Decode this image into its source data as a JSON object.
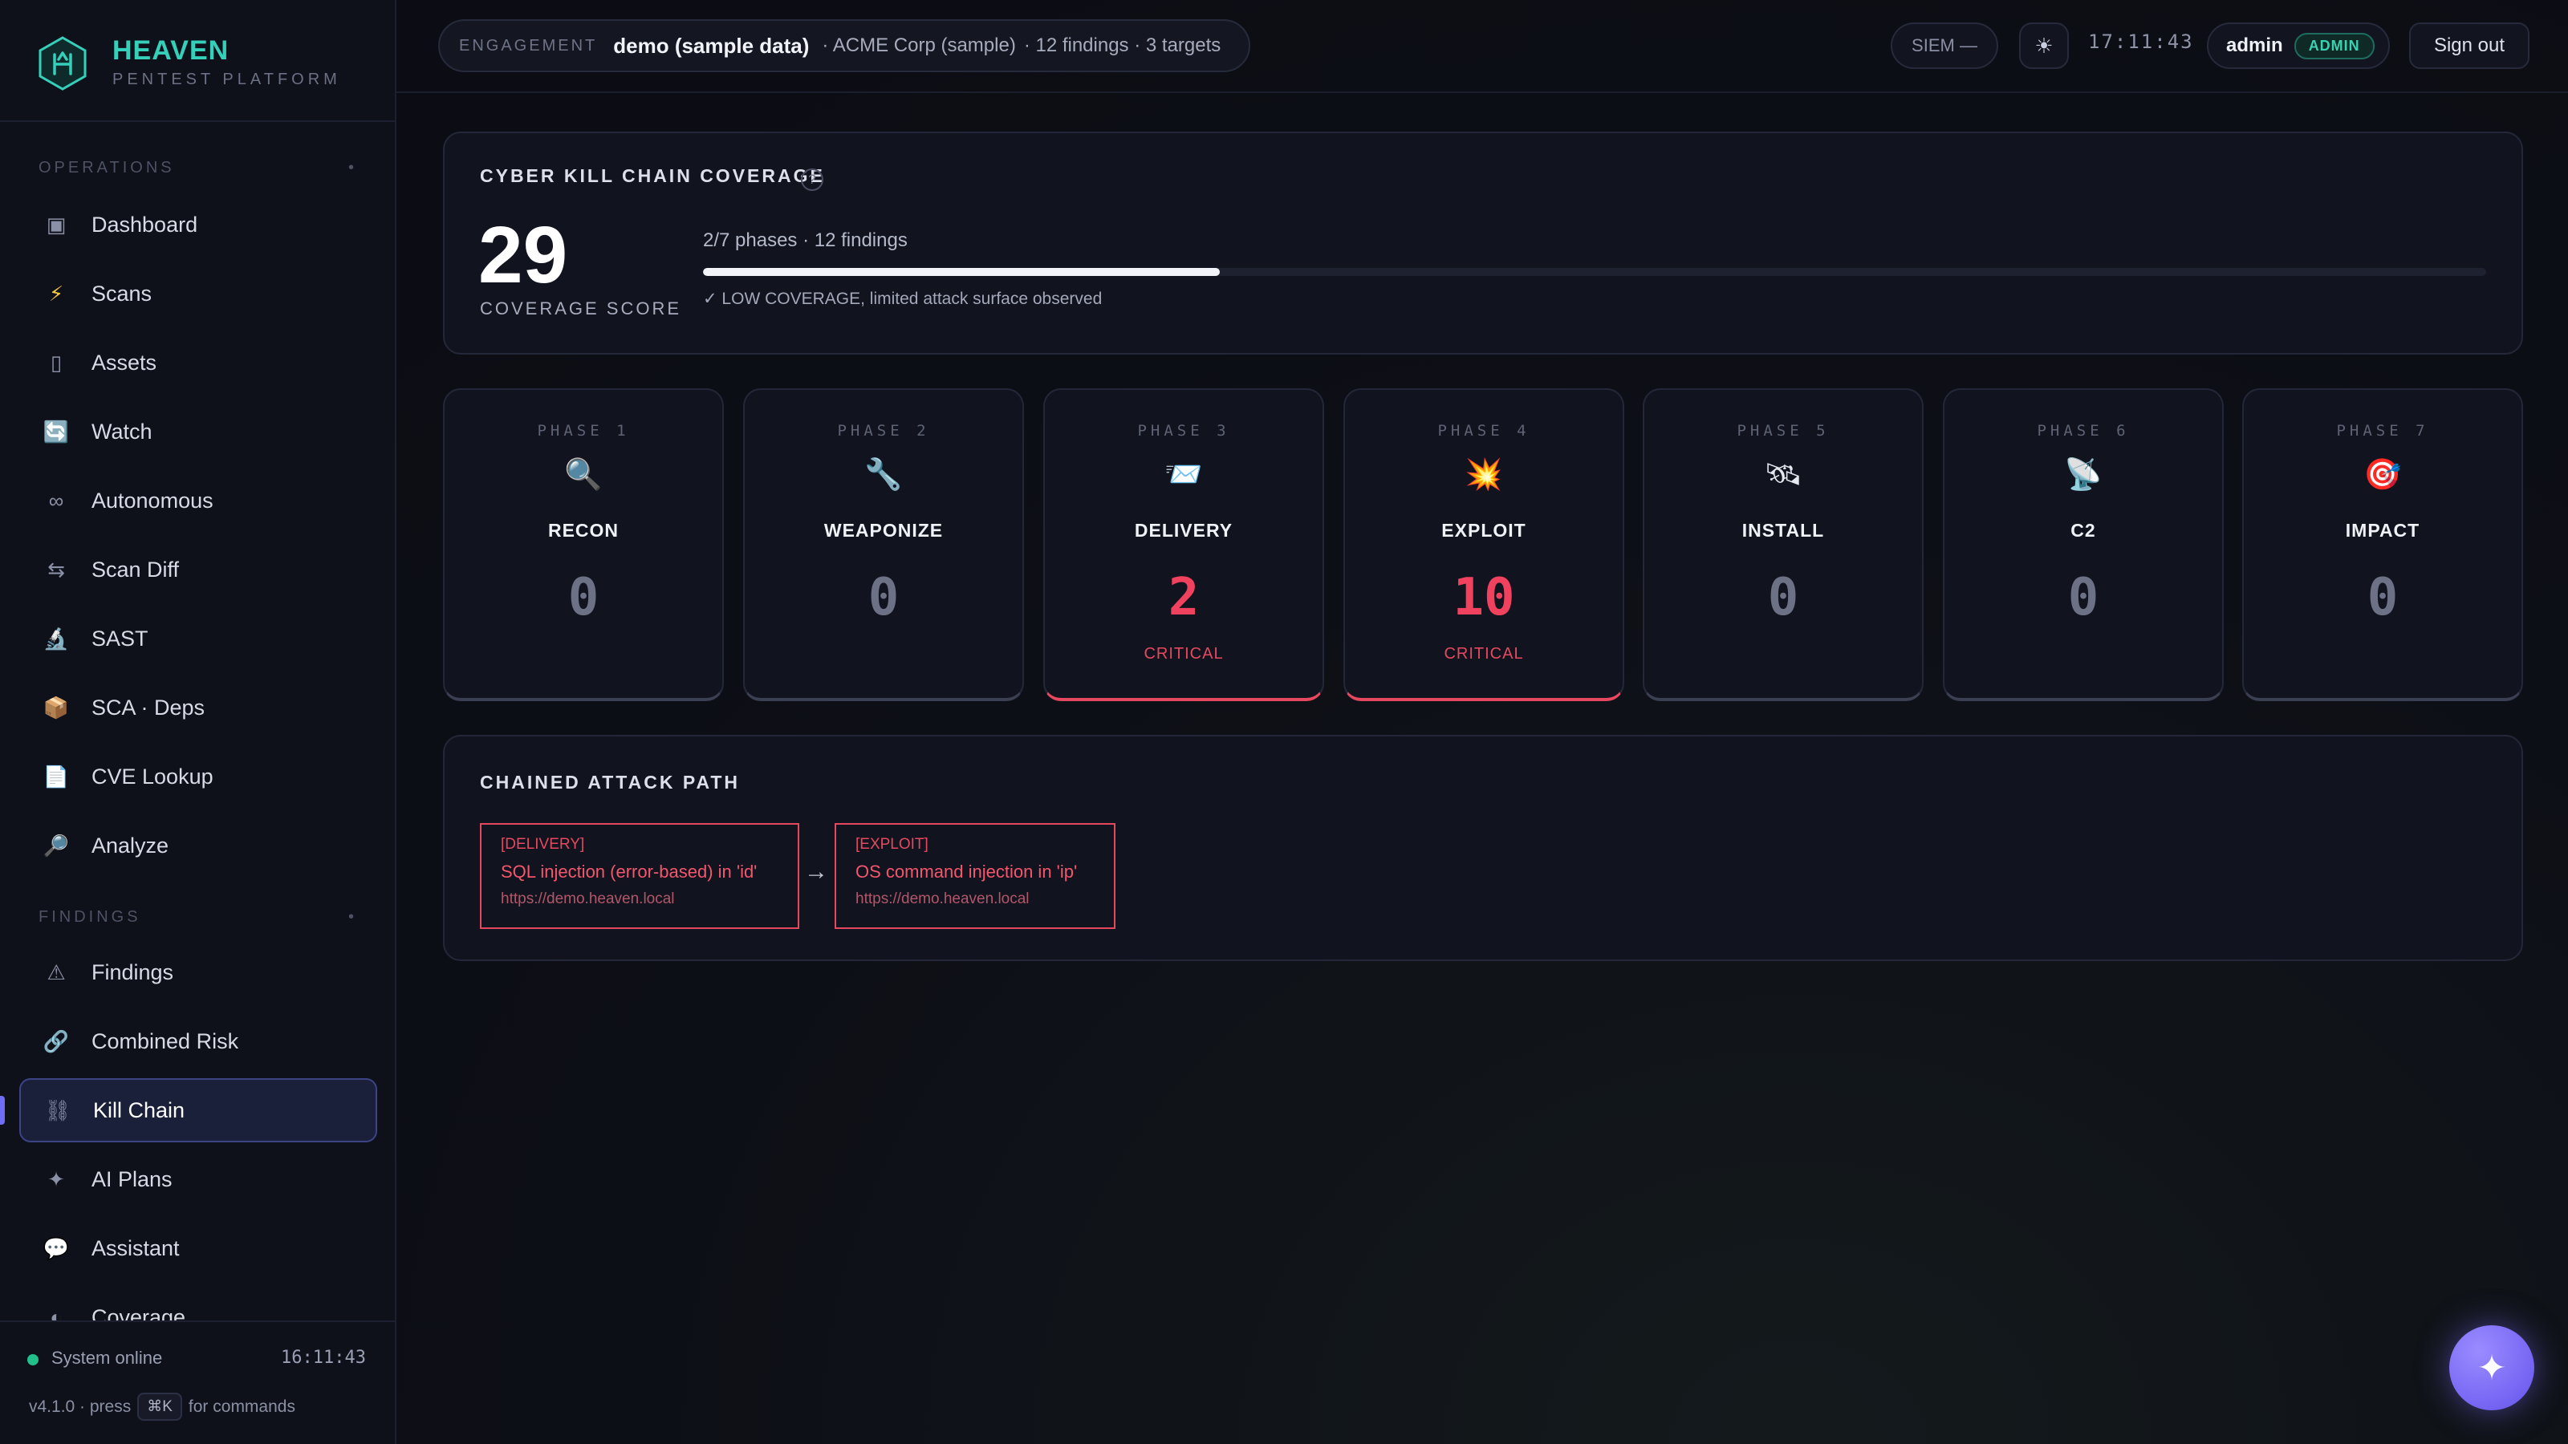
{
  "brand": {
    "name": "HEAVEN",
    "subtitle": "PENTEST PLATFORM"
  },
  "sidebar": {
    "sections": [
      {
        "label": "OPERATIONS",
        "marker": "•"
      },
      {
        "label": "FINDINGS",
        "marker": "•"
      }
    ],
    "operations": [
      {
        "icon": "dashboard-icon",
        "glyph": "▣",
        "label": "Dashboard"
      },
      {
        "icon": "lightning-icon",
        "glyph": "⚡",
        "label": "Scans"
      },
      {
        "icon": "server-icon",
        "glyph": "▯",
        "label": "Assets"
      },
      {
        "icon": "refresh-icon",
        "glyph": "🔄",
        "label": "Watch"
      },
      {
        "icon": "infinity-icon",
        "glyph": "∞",
        "label": "Autonomous"
      },
      {
        "icon": "diff-icon",
        "glyph": "⇆",
        "label": "Scan Diff"
      },
      {
        "icon": "microscope-icon",
        "glyph": "🔬",
        "label": "SAST"
      },
      {
        "icon": "package-icon",
        "glyph": "📦",
        "label": "SCA · Deps"
      },
      {
        "icon": "document-icon",
        "glyph": "📄",
        "label": "CVE Lookup"
      },
      {
        "icon": "magnifier-icon",
        "glyph": "🔎",
        "label": "Analyze"
      }
    ],
    "findings": [
      {
        "icon": "warning-icon",
        "glyph": "⚠",
        "label": "Findings"
      },
      {
        "icon": "link-icon",
        "glyph": "🔗",
        "label": "Combined Risk"
      },
      {
        "icon": "chain-icon",
        "glyph": "⛓",
        "label": "Kill Chain",
        "active": true
      },
      {
        "icon": "sparkle-icon",
        "glyph": "✦",
        "label": "AI Plans"
      },
      {
        "icon": "chat-icon",
        "glyph": "💬",
        "label": "Assistant"
      },
      {
        "icon": "half-circle-icon",
        "glyph": "◐",
        "label": "Coverage"
      }
    ],
    "footer": {
      "status": "System online",
      "time": "16:11:43",
      "version_prefix": "v4.1.0 · press",
      "shortcut": "⌘K",
      "version_suffix": "for commands"
    }
  },
  "topbar": {
    "engagement_label": "ENGAGEMENT",
    "engagement_name": "demo (sample data)",
    "engagement_client": "· ACME Corp (sample)",
    "engagement_stats": "· 12 findings · 3 targets",
    "siem": "SIEM —",
    "theme_icon": "☀",
    "clock": "17:11:43",
    "user": "admin",
    "role": "ADMIN",
    "signout": "Sign out"
  },
  "coverage": {
    "title": "CYBER KILL CHAIN COVERAGE",
    "help": "?",
    "score": "29",
    "score_label": "COVERAGE SCORE",
    "meta": "2/7 phases · 12 findings",
    "progress": 0.29,
    "note": "✓ LOW COVERAGE, limited attack surface observed"
  },
  "phases": [
    {
      "num": "PHASE 1",
      "icon": "magnifier-icon",
      "glyph": "🔍",
      "name": "RECON",
      "count": "0",
      "severity": ""
    },
    {
      "num": "PHASE 2",
      "icon": "wrench-icon",
      "glyph": "🔧",
      "name": "WEAPONIZE",
      "count": "0",
      "severity": ""
    },
    {
      "num": "PHASE 3",
      "icon": "inbox-icon",
      "glyph": "📨",
      "name": "DELIVERY",
      "count": "2",
      "severity": "CRITICAL"
    },
    {
      "num": "PHASE 4",
      "icon": "explosion-icon",
      "glyph": "💥",
      "name": "EXPLOIT",
      "count": "10",
      "severity": "CRITICAL"
    },
    {
      "num": "PHASE 5",
      "icon": "satellite-icon",
      "glyph": "🛰",
      "name": "INSTALL",
      "count": "0",
      "severity": ""
    },
    {
      "num": "PHASE 6",
      "icon": "antenna-icon",
      "glyph": "📡",
      "name": "C2",
      "count": "0",
      "severity": ""
    },
    {
      "num": "PHASE 7",
      "icon": "target-icon",
      "glyph": "🎯",
      "name": "IMPACT",
      "count": "0",
      "severity": ""
    }
  ],
  "chain": {
    "title": "CHAINED ATTACK PATH",
    "arrow": "→",
    "steps": [
      {
        "tag": "[DELIVERY]",
        "title": "SQL injection (error-based) in 'id'",
        "url": "https://demo.heaven.local"
      },
      {
        "tag": "[EXPLOIT]",
        "title": "OS command injection in 'ip'",
        "url": "https://demo.heaven.local"
      }
    ]
  },
  "fab": {
    "icon": "sparkle-icon",
    "glyph": "✦"
  },
  "colors": {
    "accent": "#35d0ba",
    "critical": "#e5485f",
    "active": "#6f6cf6"
  }
}
